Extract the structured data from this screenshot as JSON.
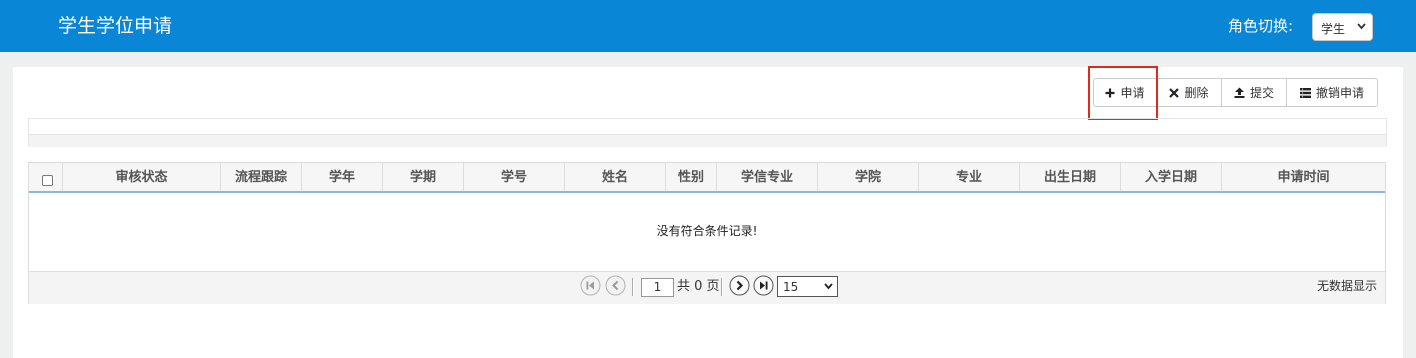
{
  "header": {
    "title": "学生学位申请",
    "role_label": "角色切换:",
    "role_selected": "学生"
  },
  "toolbar": {
    "apply": "申请",
    "delete": "删除",
    "submit": "提交",
    "cancel_apply": "撤销申请"
  },
  "grid": {
    "columns": [
      "审核状态",
      "流程跟踪",
      "学年",
      "学期",
      "学号",
      "姓名",
      "性别",
      "学信专业",
      "学院",
      "专业",
      "出生日期",
      "入学日期",
      "申请时间"
    ],
    "empty_message": "没有符合条件记录!"
  },
  "pager": {
    "page": "1",
    "total_text": "共 0 页",
    "page_size": "15",
    "no_data_text": "无数据显示"
  },
  "colors": {
    "header_bg": "#0a86d6",
    "highlight": "#e02a1b"
  }
}
